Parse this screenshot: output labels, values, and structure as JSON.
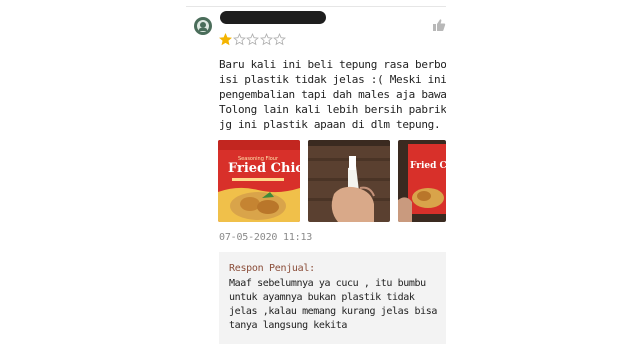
{
  "review": {
    "rating": 1,
    "max_rating": 5,
    "star_color": "#f4b400",
    "text_lines": [
      "Baru kali ini beli tepung rasa berbonus c",
      "isi plastik tidak jelas :( Meski ini bisa 'I",
      "pengembalian tapi dah males aja bawaa",
      "Tolong lain kali lebih bersih pabriknya. C",
      "jg ini plastik apaan di dlm tepung."
    ],
    "photos": [
      {
        "caption": "Fried Chicken"
      },
      {
        "caption": ""
      },
      {
        "caption": "Fried Chicken"
      }
    ],
    "date": "07-05-2020 11:13"
  },
  "seller_response": {
    "title": "Respon Penjual:",
    "lines": [
      "Maaf sebelumnya ya cucu , itu bumbu",
      "untuk ayamnya bukan plastik tidak",
      "jelas ,kalau memang kurang jelas bisa",
      "tanya langsung kekita"
    ]
  }
}
